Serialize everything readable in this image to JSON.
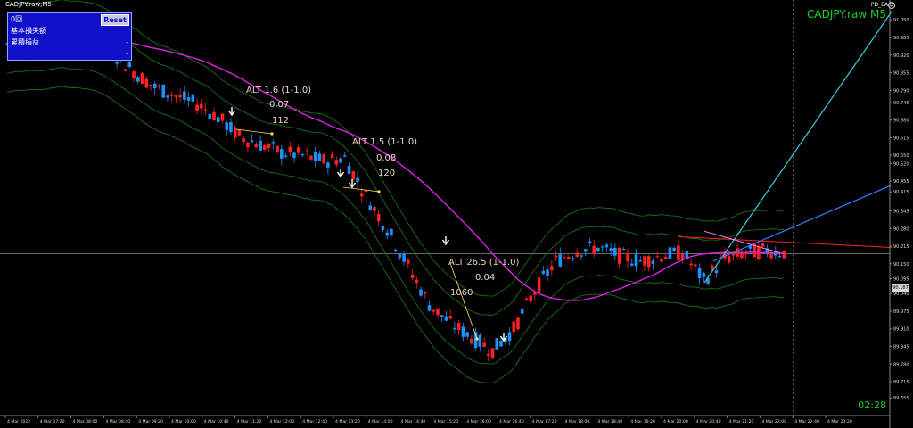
{
  "window_title": "CADJPY.raw,M5",
  "ea_label": "PD_EA",
  "ea_icon_glyph": "☺",
  "symbol_label": "CADJPY.raw M5",
  "timer": "02:28",
  "panel": {
    "row1": "0回",
    "row2": "基本損失額",
    "row3": "累積損益",
    "reset_label": "Reset",
    "row2_value": "-",
    "row3_value": "-"
  },
  "annotations": [
    {
      "line1": "ALT 1.6 (1-1.0)",
      "line2": "0.07",
      "line3": "112"
    },
    {
      "line1": "ALT 1.5 (1-1.0)",
      "line2": "0.08",
      "line3": "120"
    },
    {
      "line1": "ALT 26.5 (1-1.0)",
      "line2": "0.04",
      "line3": "1060"
    }
  ],
  "current_price": "90.187",
  "colors": {
    "background": "#000000",
    "bull": "#1e90ff",
    "bear": "#ff2020",
    "ma_slow": "#e020e0",
    "bands": "#1a7a1a",
    "trend_red": "#ff2020",
    "trend_cyan": "#30d0e0",
    "trend_blue": "#3080ff",
    "symbol_text": "#19d22a"
  },
  "chart_data": {
    "type": "candlestick",
    "y_ticks": [
      "91.110",
      "91.050",
      "90.985",
      "90.920",
      "90.855",
      "90.790",
      "90.745",
      "90.680",
      "90.615",
      "90.550",
      "90.520",
      "90.455",
      "90.415",
      "90.345",
      "90.280",
      "90.215",
      "90.150",
      "90.095",
      "90.040",
      "89.975",
      "89.910",
      "89.845",
      "89.780",
      "89.715",
      "89.655",
      "89.590"
    ],
    "x_ticks": [
      "4 Mar 2022",
      "4 Mar 07:20",
      "4 Mar 08:00",
      "4 Mar 08:40",
      "4 Mar 09:20",
      "4 Mar 10:00",
      "4 Mar 10:40",
      "4 Mar 11:20",
      "4 Mar 12:00",
      "4 Mar 12:40",
      "4 Mar 13:20",
      "4 Mar 14:00",
      "4 Mar 14:40",
      "4 Mar 15:20",
      "4 Mar 16:00",
      "4 Mar 16:40",
      "4 Mar 17:20",
      "4 Mar 18:00",
      "4 Mar 18:40",
      "4 Mar 19:20",
      "4 Mar 20:00",
      "4 Mar 20:40",
      "4 Mar 21:20",
      "4 Mar 22:00",
      "4 Mar 22:40",
      "4 Mar 23:20"
    ],
    "ylim": [
      89.59,
      91.11
    ],
    "trend_path": [
      [
        0,
        90.96
      ],
      [
        10,
        90.95
      ],
      [
        20,
        90.96
      ],
      [
        30,
        90.97
      ],
      [
        40,
        90.95
      ],
      [
        50,
        90.93
      ],
      [
        60,
        90.86
      ],
      [
        70,
        90.8
      ],
      [
        80,
        90.77
      ],
      [
        90,
        90.74
      ],
      [
        100,
        90.69
      ],
      [
        110,
        90.62
      ],
      [
        120,
        90.59
      ],
      [
        130,
        90.56
      ],
      [
        140,
        90.55
      ],
      [
        150,
        90.53
      ],
      [
        160,
        90.54
      ],
      [
        170,
        90.4
      ],
      [
        180,
        90.28
      ],
      [
        190,
        90.14
      ],
      [
        200,
        90.0
      ],
      [
        210,
        89.93
      ],
      [
        220,
        89.88
      ],
      [
        230,
        89.83
      ],
      [
        240,
        89.91
      ],
      [
        250,
        90.05
      ],
      [
        260,
        90.16
      ],
      [
        270,
        90.2
      ],
      [
        280,
        90.21
      ],
      [
        290,
        90.18
      ],
      [
        300,
        90.16
      ],
      [
        310,
        90.18
      ],
      [
        320,
        90.19
      ],
      [
        330,
        90.09
      ],
      [
        340,
        90.17
      ],
      [
        350,
        90.19
      ],
      [
        360,
        90.2
      ],
      [
        370,
        90.19
      ]
    ]
  }
}
